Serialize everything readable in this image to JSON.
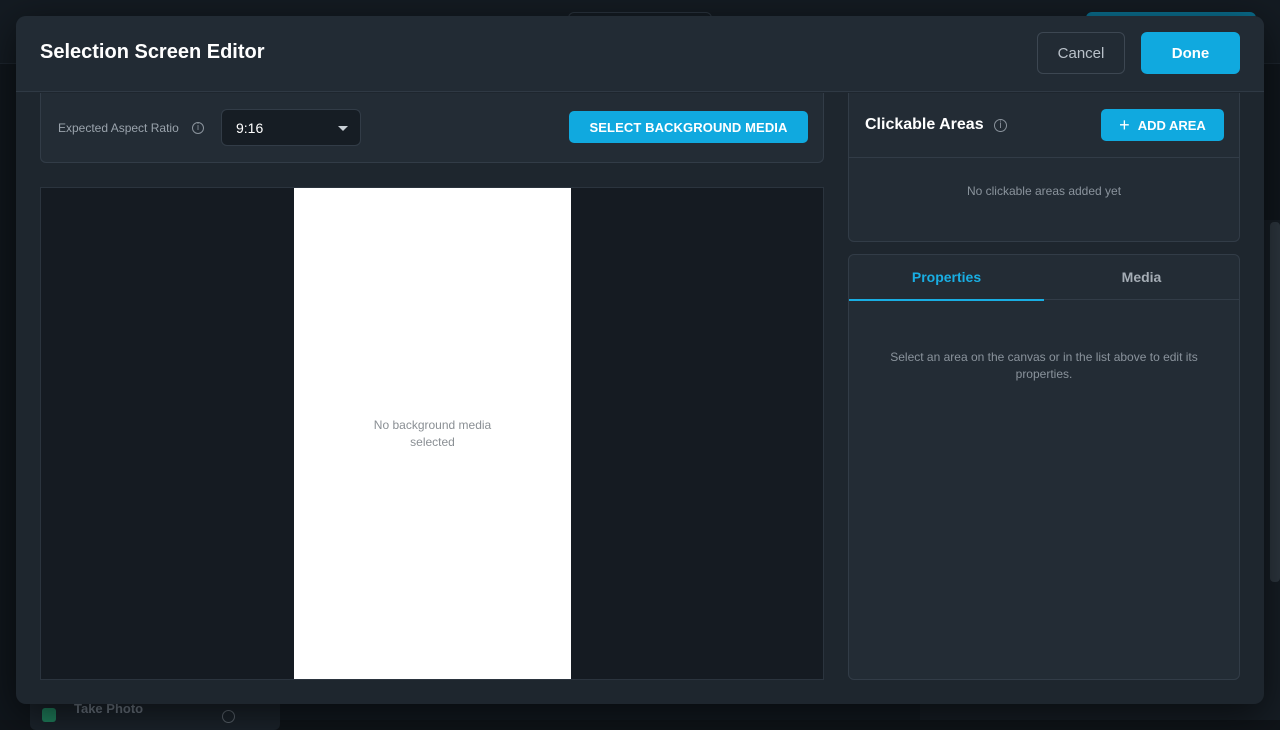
{
  "background": {
    "card_label": "Take Photo"
  },
  "modal": {
    "title": "Selection Screen Editor",
    "cancel_label": "Cancel",
    "done_label": "Done"
  },
  "toolbar": {
    "aspect_ratio_label": "Expected Aspect Ratio",
    "aspect_ratio_value": "9:16",
    "select_bg_label": "SELECT BACKGROUND MEDIA"
  },
  "canvas": {
    "empty_line1": "No background media",
    "empty_line2": "selected"
  },
  "clickable_areas": {
    "title": "Clickable Areas",
    "add_label": "ADD AREA",
    "empty_text": "No clickable areas added yet"
  },
  "properties": {
    "tabs": [
      {
        "label": "Properties",
        "active": true
      },
      {
        "label": "Media",
        "active": false
      }
    ],
    "empty_text": "Select an area on the canvas or in the list above to edit its properties."
  },
  "colors": {
    "accent": "#10a9df",
    "modal_bg": "#1e262e",
    "canvas_bg": "#151b22"
  },
  "icons": {
    "info": "info-icon",
    "caret": "chevron-down-icon",
    "plus": "plus-icon"
  }
}
